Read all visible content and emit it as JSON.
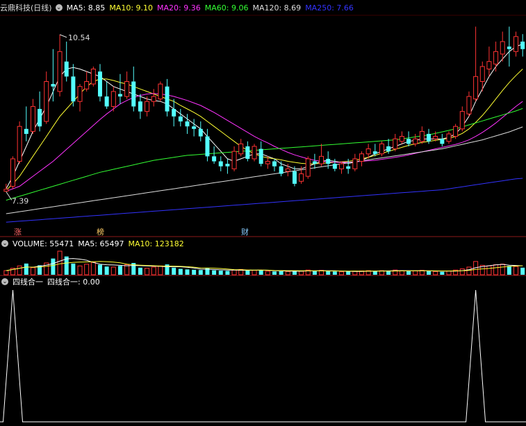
{
  "header_main": {
    "title": "云鼎科技(日线)",
    "ma": [
      {
        "label": "MA5: 8.85",
        "color": "#ffffff"
      },
      {
        "label": "MA10: 9.10",
        "color": "#ffff33"
      },
      {
        "label": "MA20: 9.36",
        "color": "#ff33ff"
      },
      {
        "label": "MA60: 9.06",
        "color": "#33ff33"
      },
      {
        "label": "MA120: 8.69",
        "color": "#dddddd"
      },
      {
        "label": "MA250: 7.66",
        "color": "#3333ff"
      }
    ]
  },
  "header_vol": {
    "title": "VOLUME: 55471",
    "ma5": "MA5: 65497",
    "ma10": "MA10: 123182"
  },
  "header_ind": {
    "title": "四线合一",
    "value": "四线合一: 0.00"
  },
  "annotations": {
    "high": "10.54",
    "low": "7.39"
  },
  "tags": [
    {
      "text": "涨",
      "color": "#ff6666"
    },
    {
      "text": "榜",
      "color": "#ffcc66"
    },
    {
      "text": "财",
      "color": "#88ccff"
    }
  ],
  "colors": {
    "up": "#ff3333",
    "down": "#54ffff",
    "volume_ma5": "#ffffff",
    "volume_ma10": "#ffff33"
  },
  "chart_data": {
    "type": "candlestick",
    "ylim": [
      6.7,
      10.9
    ],
    "candles": [
      [
        7.4,
        7.55,
        7.44,
        7.39
      ],
      [
        7.5,
        8.1,
        8.05,
        7.45
      ],
      [
        8.0,
        8.8,
        8.7,
        7.95
      ],
      [
        8.65,
        9.1,
        8.55,
        8.4
      ],
      [
        8.6,
        9.25,
        9.1,
        8.55
      ],
      [
        9.05,
        9.4,
        8.7,
        8.6
      ],
      [
        8.8,
        9.8,
        9.6,
        8.75
      ],
      [
        9.55,
        10.25,
        9.5,
        9.2
      ],
      [
        9.4,
        10.54,
        10.2,
        9.3
      ],
      [
        10.0,
        10.4,
        9.7,
        9.6
      ],
      [
        9.7,
        9.95,
        9.2,
        9.1
      ],
      [
        9.2,
        9.55,
        9.5,
        9.0
      ],
      [
        9.45,
        9.8,
        9.6,
        9.4
      ],
      [
        9.55,
        9.9,
        9.85,
        9.5
      ],
      [
        9.8,
        9.95,
        9.3,
        9.2
      ],
      [
        9.3,
        9.6,
        9.1,
        9.05
      ],
      [
        9.1,
        9.5,
        9.4,
        9.0
      ],
      [
        9.35,
        9.75,
        9.3,
        9.15
      ],
      [
        9.3,
        9.8,
        9.6,
        9.25
      ],
      [
        9.6,
        9.9,
        9.1,
        9.0
      ],
      [
        9.2,
        9.35,
        9.0,
        8.85
      ],
      [
        9.0,
        9.3,
        9.2,
        8.9
      ],
      [
        9.2,
        9.45,
        9.3,
        9.1
      ],
      [
        9.25,
        9.6,
        9.55,
        9.2
      ],
      [
        9.5,
        9.65,
        9.0,
        8.9
      ],
      [
        9.05,
        9.25,
        8.9,
        8.7
      ],
      [
        8.9,
        9.05,
        8.8,
        8.7
      ],
      [
        8.8,
        8.95,
        8.7,
        8.55
      ],
      [
        8.7,
        8.85,
        8.65,
        8.5
      ],
      [
        8.65,
        8.8,
        8.5,
        8.4
      ],
      [
        8.5,
        8.65,
        8.1,
        8.0
      ],
      [
        8.1,
        8.3,
        8.0,
        7.95
      ],
      [
        8.0,
        8.1,
        7.9,
        7.8
      ],
      [
        7.95,
        8.05,
        7.9,
        7.75
      ],
      [
        7.85,
        8.3,
        8.2,
        7.8
      ],
      [
        8.15,
        8.45,
        8.35,
        8.1
      ],
      [
        8.3,
        8.4,
        8.05,
        8.0
      ],
      [
        8.05,
        8.35,
        8.3,
        8.0
      ],
      [
        8.25,
        8.4,
        7.95,
        7.9
      ],
      [
        7.95,
        8.1,
        8.0,
        7.85
      ],
      [
        8.0,
        8.05,
        7.9,
        7.8
      ],
      [
        7.9,
        8.0,
        7.75,
        7.7
      ],
      [
        7.8,
        7.95,
        7.85,
        7.7
      ],
      [
        7.8,
        7.9,
        7.55,
        7.5
      ],
      [
        7.6,
        7.9,
        7.75,
        7.55
      ],
      [
        7.7,
        8.1,
        8.05,
        7.65
      ],
      [
        8.0,
        8.15,
        7.95,
        7.85
      ],
      [
        7.95,
        8.35,
        8.1,
        7.9
      ],
      [
        8.05,
        8.2,
        7.95,
        7.85
      ],
      [
        7.95,
        8.05,
        7.85,
        7.8
      ],
      [
        7.85,
        8.0,
        7.95,
        7.75
      ],
      [
        7.9,
        8.05,
        7.85,
        7.75
      ],
      [
        7.85,
        8.15,
        8.05,
        7.8
      ],
      [
        8.0,
        8.2,
        8.15,
        7.9
      ],
      [
        8.15,
        8.35,
        8.25,
        8.05
      ],
      [
        8.2,
        8.35,
        8.15,
        8.1
      ],
      [
        8.15,
        8.4,
        8.35,
        8.1
      ],
      [
        8.3,
        8.45,
        8.2,
        8.15
      ],
      [
        8.25,
        8.55,
        8.45,
        8.2
      ],
      [
        8.4,
        8.6,
        8.5,
        8.35
      ],
      [
        8.45,
        8.6,
        8.35,
        8.3
      ],
      [
        8.35,
        8.55,
        8.45,
        8.3
      ],
      [
        8.4,
        8.7,
        8.6,
        8.35
      ],
      [
        8.55,
        8.65,
        8.4,
        8.35
      ],
      [
        8.45,
        8.6,
        8.5,
        8.4
      ],
      [
        8.45,
        8.55,
        8.35,
        8.3
      ],
      [
        8.4,
        8.6,
        8.55,
        8.35
      ],
      [
        8.5,
        8.75,
        8.7,
        8.45
      ],
      [
        8.65,
        9.1,
        9.0,
        8.6
      ],
      [
        8.95,
        9.4,
        9.3,
        8.9
      ],
      [
        9.25,
        10.7,
        9.7,
        9.2
      ],
      [
        9.6,
        10.0,
        9.9,
        9.4
      ],
      [
        9.85,
        10.3,
        10.0,
        9.7
      ],
      [
        9.95,
        10.4,
        10.2,
        9.8
      ],
      [
        10.15,
        10.6,
        10.4,
        10.0
      ],
      [
        10.3,
        10.7,
        10.25,
        9.9
      ],
      [
        10.2,
        10.6,
        10.5,
        10.1
      ],
      [
        10.4,
        10.55,
        10.25,
        10.1
      ]
    ],
    "volumes": [
      14,
      22,
      30,
      38,
      24,
      32,
      40,
      55,
      80,
      62,
      38,
      30,
      36,
      42,
      34,
      28,
      26,
      30,
      34,
      40,
      24,
      22,
      26,
      30,
      35,
      24,
      20,
      18,
      17,
      16,
      22,
      15,
      14,
      13,
      16,
      18,
      14,
      15,
      16,
      12,
      11,
      12,
      11,
      14,
      12,
      16,
      13,
      15,
      12,
      11,
      10,
      11,
      12,
      13,
      14,
      12,
      14,
      13,
      16,
      14,
      12,
      13,
      15,
      12,
      11,
      10,
      13,
      16,
      20,
      26,
      45,
      32,
      30,
      34,
      36,
      30,
      28,
      24
    ],
    "ma": [
      {
        "name": "MA5",
        "color": "#ffffff",
        "values": [
          7.45,
          7.7,
          8.0,
          8.3,
          8.6,
          8.85,
          9.1,
          9.4,
          9.7,
          9.85,
          9.88,
          9.85,
          9.8,
          9.75,
          9.7,
          9.6,
          9.5,
          9.45,
          9.4,
          9.35,
          9.3,
          9.25,
          9.22,
          9.2,
          9.15,
          9.05,
          8.95,
          8.85,
          8.75,
          8.65,
          8.5,
          8.35,
          8.2,
          8.05,
          8.0,
          8.05,
          8.1,
          8.15,
          8.15,
          8.1,
          8.05,
          7.95,
          7.9,
          7.85,
          7.85,
          7.9,
          7.95,
          8.0,
          8.02,
          8.0,
          7.98,
          7.96,
          7.98,
          8.02,
          8.08,
          8.15,
          8.2,
          8.25,
          8.3,
          8.35,
          8.4,
          8.42,
          8.45,
          8.45,
          8.45,
          8.45,
          8.48,
          8.55,
          8.7,
          8.9,
          9.2,
          9.45,
          9.7,
          9.9,
          10.05,
          10.2,
          10.3,
          10.35
        ]
      },
      {
        "name": "MA10",
        "color": "#ffff33",
        "values": [
          7.42,
          7.55,
          7.7,
          7.9,
          8.1,
          8.3,
          8.5,
          8.7,
          8.9,
          9.05,
          9.2,
          9.35,
          9.5,
          9.6,
          9.65,
          9.65,
          9.62,
          9.58,
          9.55,
          9.5,
          9.45,
          9.4,
          9.35,
          9.3,
          9.25,
          9.2,
          9.12,
          9.05,
          8.98,
          8.9,
          8.8,
          8.7,
          8.6,
          8.5,
          8.4,
          8.3,
          8.22,
          8.15,
          8.1,
          8.07,
          8.05,
          8.03,
          8.0,
          7.98,
          7.96,
          7.95,
          7.95,
          7.96,
          7.97,
          7.98,
          7.99,
          8.0,
          8.02,
          8.05,
          8.08,
          8.12,
          8.16,
          8.2,
          8.24,
          8.28,
          8.32,
          8.35,
          8.38,
          8.4,
          8.42,
          8.44,
          8.46,
          8.5,
          8.56,
          8.65,
          8.78,
          8.92,
          9.08,
          9.25,
          9.42,
          9.58,
          9.72,
          9.85
        ]
      },
      {
        "name": "MA20",
        "color": "#ff33ff",
        "values": [
          7.4,
          7.45,
          7.5,
          7.6,
          7.7,
          7.8,
          7.9,
          8.0,
          8.12,
          8.24,
          8.36,
          8.48,
          8.6,
          8.72,
          8.84,
          8.95,
          9.05,
          9.15,
          9.22,
          9.28,
          9.32,
          9.35,
          9.36,
          9.35,
          9.33,
          9.3,
          9.26,
          9.22,
          9.17,
          9.12,
          9.05,
          8.98,
          8.9,
          8.82,
          8.74,
          8.66,
          8.58,
          8.5,
          8.43,
          8.37,
          8.3,
          8.24,
          8.18,
          8.13,
          8.09,
          8.05,
          8.02,
          8.0,
          7.99,
          7.98,
          7.98,
          7.98,
          7.99,
          8.0,
          8.01,
          8.02,
          8.04,
          8.06,
          8.08,
          8.1,
          8.13,
          8.16,
          8.19,
          8.22,
          8.25,
          8.28,
          8.31,
          8.34,
          8.38,
          8.43,
          8.5,
          8.58,
          8.67,
          8.77,
          8.88,
          8.99,
          9.1,
          9.2
        ]
      },
      {
        "name": "MA60",
        "color": "#33ff33",
        "values": [
          7.22,
          7.26,
          7.3,
          7.34,
          7.38,
          7.42,
          7.46,
          7.5,
          7.54,
          7.58,
          7.62,
          7.66,
          7.7,
          7.74,
          7.78,
          7.81,
          7.84,
          7.87,
          7.9,
          7.93,
          7.96,
          7.99,
          8.02,
          8.04,
          8.06,
          8.08,
          8.1,
          8.12,
          8.13,
          8.14,
          8.15,
          8.16,
          8.17,
          8.18,
          8.19,
          8.2,
          8.21,
          8.22,
          8.23,
          8.24,
          8.25,
          8.26,
          8.27,
          8.28,
          8.29,
          8.3,
          8.31,
          8.32,
          8.33,
          8.34,
          8.35,
          8.36,
          8.37,
          8.38,
          8.39,
          8.4,
          8.41,
          8.42,
          8.43,
          8.45,
          8.47,
          8.49,
          8.51,
          8.53,
          8.56,
          8.59,
          8.62,
          8.65,
          8.69,
          8.73,
          8.77,
          8.81,
          8.85,
          8.89,
          8.93,
          8.97,
          9.01,
          9.06
        ]
      },
      {
        "name": "MA120",
        "color": "#dddddd",
        "values": [
          6.95,
          6.97,
          6.99,
          7.01,
          7.03,
          7.05,
          7.07,
          7.09,
          7.11,
          7.13,
          7.15,
          7.17,
          7.19,
          7.21,
          7.23,
          7.25,
          7.27,
          7.29,
          7.31,
          7.33,
          7.35,
          7.37,
          7.39,
          7.41,
          7.43,
          7.45,
          7.47,
          7.49,
          7.51,
          7.53,
          7.55,
          7.57,
          7.59,
          7.61,
          7.63,
          7.65,
          7.67,
          7.69,
          7.71,
          7.73,
          7.75,
          7.77,
          7.79,
          7.81,
          7.83,
          7.85,
          7.87,
          7.89,
          7.91,
          7.93,
          7.95,
          7.97,
          7.99,
          8.01,
          8.03,
          8.05,
          8.07,
          8.09,
          8.11,
          8.13,
          8.15,
          8.17,
          8.19,
          8.21,
          8.23,
          8.25,
          8.28,
          8.31,
          8.34,
          8.37,
          8.4,
          8.43,
          8.47,
          8.51,
          8.55,
          8.59,
          8.64,
          8.69
        ]
      },
      {
        "name": "MA250",
        "color": "#3333ff",
        "values": [
          6.78,
          6.79,
          6.8,
          6.81,
          6.82,
          6.83,
          6.84,
          6.85,
          6.86,
          6.87,
          6.88,
          6.89,
          6.9,
          6.91,
          6.92,
          6.93,
          6.94,
          6.95,
          6.96,
          6.97,
          6.98,
          6.99,
          7.0,
          7.01,
          7.02,
          7.03,
          7.04,
          7.05,
          7.06,
          7.07,
          7.08,
          7.09,
          7.1,
          7.11,
          7.12,
          7.13,
          7.14,
          7.15,
          7.16,
          7.17,
          7.18,
          7.19,
          7.2,
          7.21,
          7.22,
          7.23,
          7.24,
          7.25,
          7.26,
          7.27,
          7.28,
          7.29,
          7.3,
          7.31,
          7.32,
          7.33,
          7.34,
          7.35,
          7.36,
          7.37,
          7.38,
          7.39,
          7.4,
          7.41,
          7.42,
          7.43,
          7.45,
          7.47,
          7.49,
          7.51,
          7.53,
          7.55,
          7.57,
          7.59,
          7.61,
          7.63,
          7.65,
          7.66
        ]
      }
    ],
    "indicator": {
      "name": "四线合一",
      "peaks": [
        1,
        70
      ],
      "ylim": [
        0,
        1
      ]
    }
  }
}
